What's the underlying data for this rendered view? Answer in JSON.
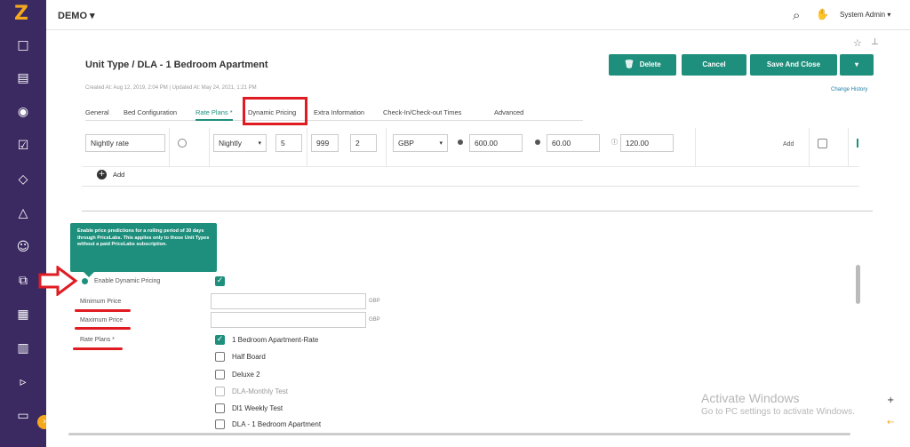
{
  "sidebar": {
    "logo": "Z",
    "expand_icon": "›"
  },
  "topbar": {
    "workspace": "DEMO ▾",
    "search_icon": "⌕",
    "hand_icon": "✋",
    "user": "System Admin ▾"
  },
  "header": {
    "title": "Unit Type / DLA - 1 Bedroom Apartment",
    "meta": "Created At: Aug 12, 2019, 2:04 PM  |  Updated At: May 24, 2021, 1:21 PM",
    "delete_label": "Delete",
    "cancel_label": "Cancel",
    "save_label": "Save And Close",
    "caret_label": "▾",
    "change_history": "Change History"
  },
  "tabs": [
    {
      "label": "General"
    },
    {
      "label": "Bed Configuration"
    },
    {
      "label": "Rate Plans *"
    },
    {
      "label": "Dynamic Pricing"
    },
    {
      "label": "Extra Information"
    },
    {
      "label": "Check-In/Check-out Times"
    },
    {
      "label": "Advanced"
    }
  ],
  "rate_row": {
    "name": "Nightly rate",
    "frequency": "Nightly",
    "frequency_caret": "▾",
    "min_nights": "5",
    "max_nights": "999",
    "guests": "2",
    "currency": "GBP",
    "currency_caret": "▾",
    "price": "600.00",
    "extra": "60.00",
    "info_icon": "ⓘ",
    "fee": "120.00",
    "add_label": "Add"
  },
  "add_row": {
    "plus_icon": "+",
    "label": "Add"
  },
  "tooltip": "Enable price predictions for a rolling period of 30 days through PriceLabs. This applies only to those Unit Types without a paid PriceLabs subscription.",
  "dynamic_pricing": {
    "enable_label": "Enable Dynamic Pricing",
    "enabled": true,
    "min_price_label": "Minimum Price",
    "max_price_label": "Maximum Price",
    "min_currency": "GBP",
    "max_currency": "GBP",
    "rate_plans_label": "Rate Plans *",
    "rate_plans": [
      {
        "label": "1 Bedroom Apartment-Rate",
        "checked": true,
        "disabled": false
      },
      {
        "label": "Half Board",
        "checked": false,
        "disabled": false
      },
      {
        "label": "Deluxe 2",
        "checked": false,
        "disabled": false
      },
      {
        "label": "DLA-Monthly Test",
        "checked": false,
        "disabled": true
      },
      {
        "label": "Dl1 Weekly Test",
        "checked": false,
        "disabled": false
      },
      {
        "label": "DLA - 1 Bedroom Apartment",
        "checked": false,
        "disabled": false
      }
    ]
  },
  "watermark": {
    "title": "Activate Windows",
    "subtitle": "Go to PC settings to activate Windows."
  },
  "right_rail": {
    "plus": "+",
    "arrow": "←"
  }
}
